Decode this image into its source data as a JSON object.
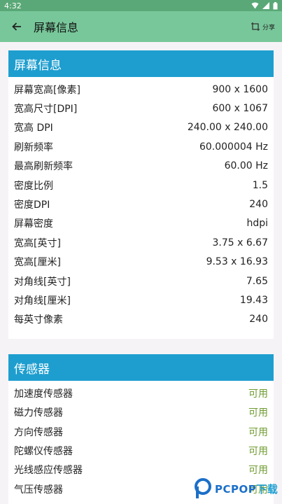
{
  "status_bar": {
    "time": "4:32"
  },
  "app_bar": {
    "title": "屏幕信息",
    "share_label": "分享"
  },
  "screen_card": {
    "header": "屏幕信息",
    "rows": [
      {
        "k": "屏幕宽高[像素]",
        "v": "900 x 1600"
      },
      {
        "k": "宽高尺寸[DPI]",
        "v": "600 x 1067"
      },
      {
        "k": "宽高 DPI",
        "v": "240.00 x 240.00"
      },
      {
        "k": "刷新频率",
        "v": "60.000004 Hz"
      },
      {
        "k": "最高刷新频率",
        "v": "60.00 Hz"
      },
      {
        "k": "密度比例",
        "v": "1.5"
      },
      {
        "k": "密度DPI",
        "v": "240"
      },
      {
        "k": "屏幕密度",
        "v": "hdpi"
      },
      {
        "k": "宽高[英寸]",
        "v": "3.75 x 6.67"
      },
      {
        "k": "宽高[厘米]",
        "v": "9.53 x 16.93"
      },
      {
        "k": "对角线[英寸]",
        "v": "7.65"
      },
      {
        "k": "对角线[厘米]",
        "v": "19.43"
      },
      {
        "k": "每英寸像素",
        "v": "240"
      }
    ]
  },
  "sensor_card": {
    "header": "传感器",
    "rows": [
      {
        "k": "加速度传感器",
        "v": "可用"
      },
      {
        "k": "磁力传感器",
        "v": "可用"
      },
      {
        "k": "方向传感器",
        "v": "可用"
      },
      {
        "k": "陀螺仪传感器",
        "v": "可用"
      },
      {
        "k": "光线感应传感器",
        "v": "可用"
      },
      {
        "k": "气压传感器",
        "v": "可用"
      }
    ]
  },
  "watermark": {
    "brand": "PCPOP",
    "cn": "下载"
  },
  "colors": {
    "status_bar": "#5aa877",
    "app_bar": "#78c79a",
    "card_header": "#1e9ecf",
    "available": "#6e9b2f"
  }
}
